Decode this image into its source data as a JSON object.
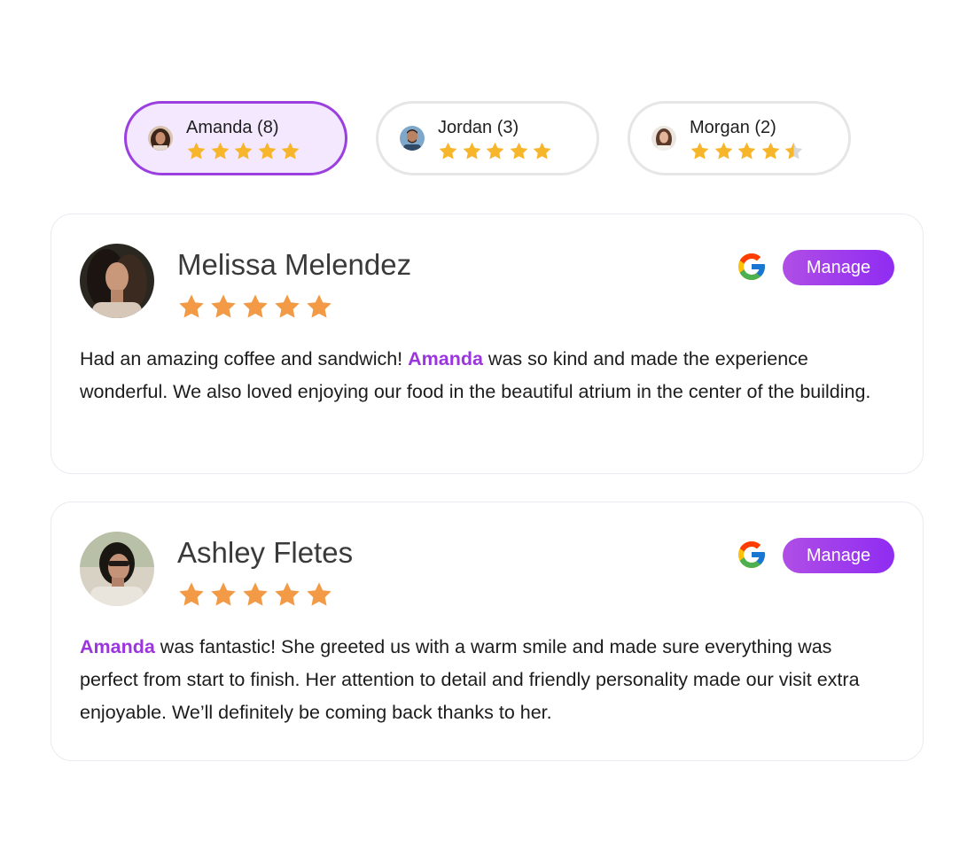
{
  "filters": [
    {
      "label": "Amanda (8)",
      "rating": 5,
      "selected": true
    },
    {
      "label": "Jordan (3)",
      "rating": 5,
      "selected": false
    },
    {
      "label": "Morgan (2)",
      "rating": 4.5,
      "selected": false
    }
  ],
  "reviews": [
    {
      "name": "Melissa Melendez",
      "rating": 5,
      "source_icon": "google-icon",
      "manage_label": "Manage",
      "text_parts": [
        {
          "text": "Had an amazing coffee and sandwich! ",
          "highlight": false
        },
        {
          "text": "Amanda",
          "highlight": true
        },
        {
          "text": " was so kind and made the experience wonderful. We also loved enjoying our food in the beautiful atrium in the center of the building.",
          "highlight": false
        }
      ]
    },
    {
      "name": "Ashley Fletes",
      "rating": 5,
      "source_icon": "google-icon",
      "manage_label": "Manage",
      "text_parts": [
        {
          "text": "Amanda",
          "highlight": true
        },
        {
          "text": " was fantastic! She greeted us with a warm smile and made sure everything was perfect from start to finish. Her attention to detail and friendly personality made our visit extra enjoyable. We’ll definitely be coming back thanks to her.",
          "highlight": false
        }
      ]
    }
  ],
  "colors": {
    "accent": "#9b3fe0",
    "selected_pill_bg": "#f3e8fd",
    "pill_star": "#f7b52c",
    "review_star": "#f29a45",
    "empty_star": "#d8d8d8",
    "mention": "#9b35dd"
  }
}
